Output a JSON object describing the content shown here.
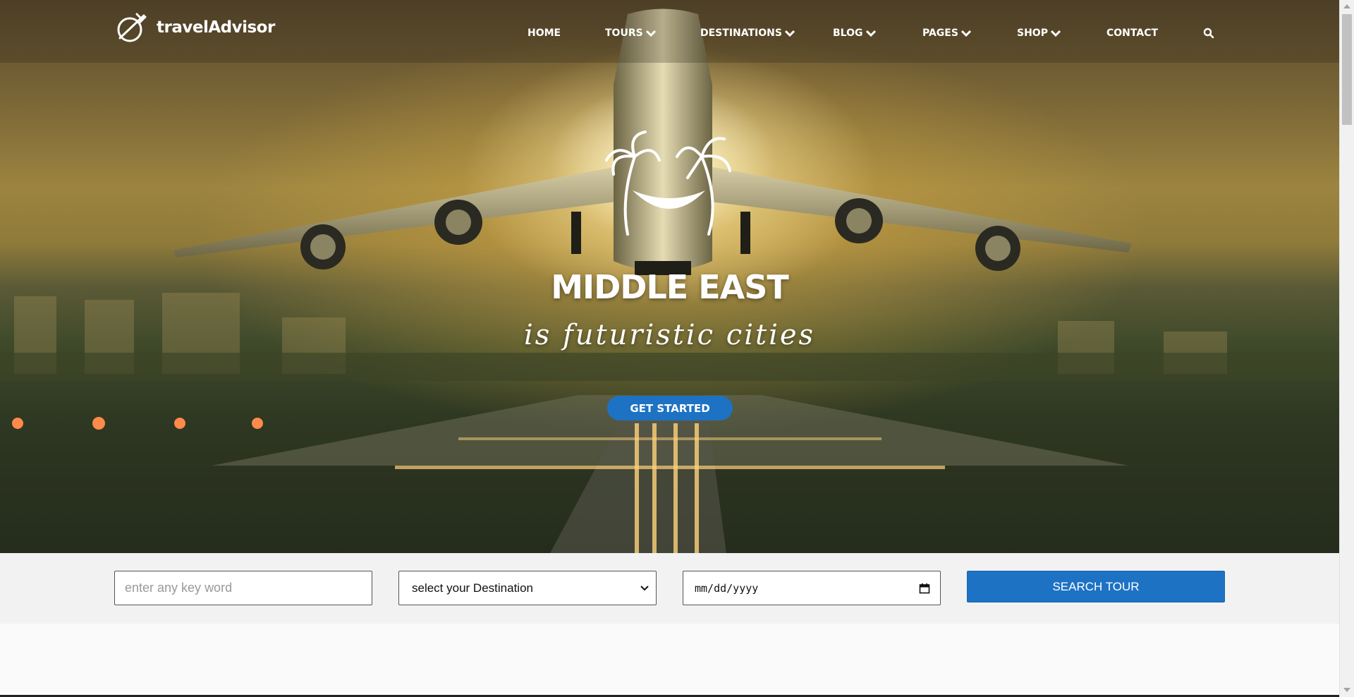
{
  "brand": {
    "name": "travelAdvisor"
  },
  "nav": {
    "items": [
      {
        "label": "HOME",
        "dropdown": false
      },
      {
        "label": "TOURS",
        "dropdown": true
      },
      {
        "label": "DESTINATIONS",
        "dropdown": true
      },
      {
        "label": "BLOG",
        "dropdown": true
      },
      {
        "label": "PAGES",
        "dropdown": true
      },
      {
        "label": "SHOP",
        "dropdown": true
      },
      {
        "label": "CONTACT",
        "dropdown": false
      }
    ],
    "search_icon": "search-icon"
  },
  "hero": {
    "title": "MIDDLE EAST",
    "subtitle": "is futuristic cities",
    "cta_label": "GET STARTED",
    "emblem_icon": "palm-trees-hammock-icon"
  },
  "search_form": {
    "keyword_placeholder": "enter any key word",
    "destination_selected": "select your Destination",
    "date_placeholder": "mm/dd/yyyy",
    "submit_label": "SEARCH TOUR"
  },
  "colors": {
    "accent": "#1d72c4",
    "text_light": "#ffffff"
  }
}
